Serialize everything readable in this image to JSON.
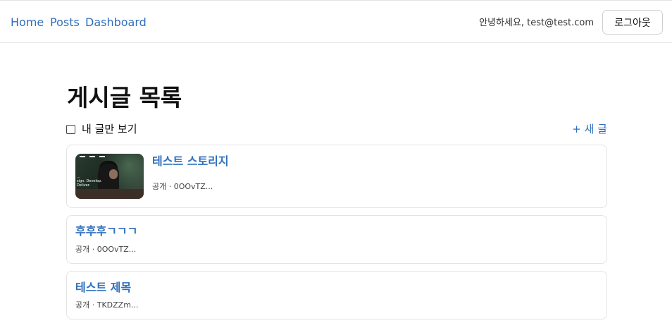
{
  "nav": {
    "home": "Home",
    "posts": "Posts",
    "dashboard": "Dashboard"
  },
  "user": {
    "greeting": "안녕하세요, test@test.com",
    "logout_label": "로그아웃"
  },
  "page": {
    "title": "게시글 목록",
    "filter_label": "내 글만 보기",
    "filter_checked": false,
    "new_post_label": "+ 새 글"
  },
  "posts": [
    {
      "title": "테스트 스토리지",
      "meta": "공개 · 0OOvTZ...",
      "has_thumbnail": true,
      "thumbnail_caption": "...\nsign. Develop.\nDeliver."
    },
    {
      "title": "후후후ㄱㄱㄱ",
      "meta": "공개 · 0OOvTZ...",
      "has_thumbnail": false
    },
    {
      "title": "테스트 제목",
      "meta": "공개 · TKDZZm...",
      "has_thumbnail": false
    }
  ],
  "colors": {
    "link": "#2f6fbd",
    "border": "#e3e3e3",
    "text": "#111111"
  }
}
